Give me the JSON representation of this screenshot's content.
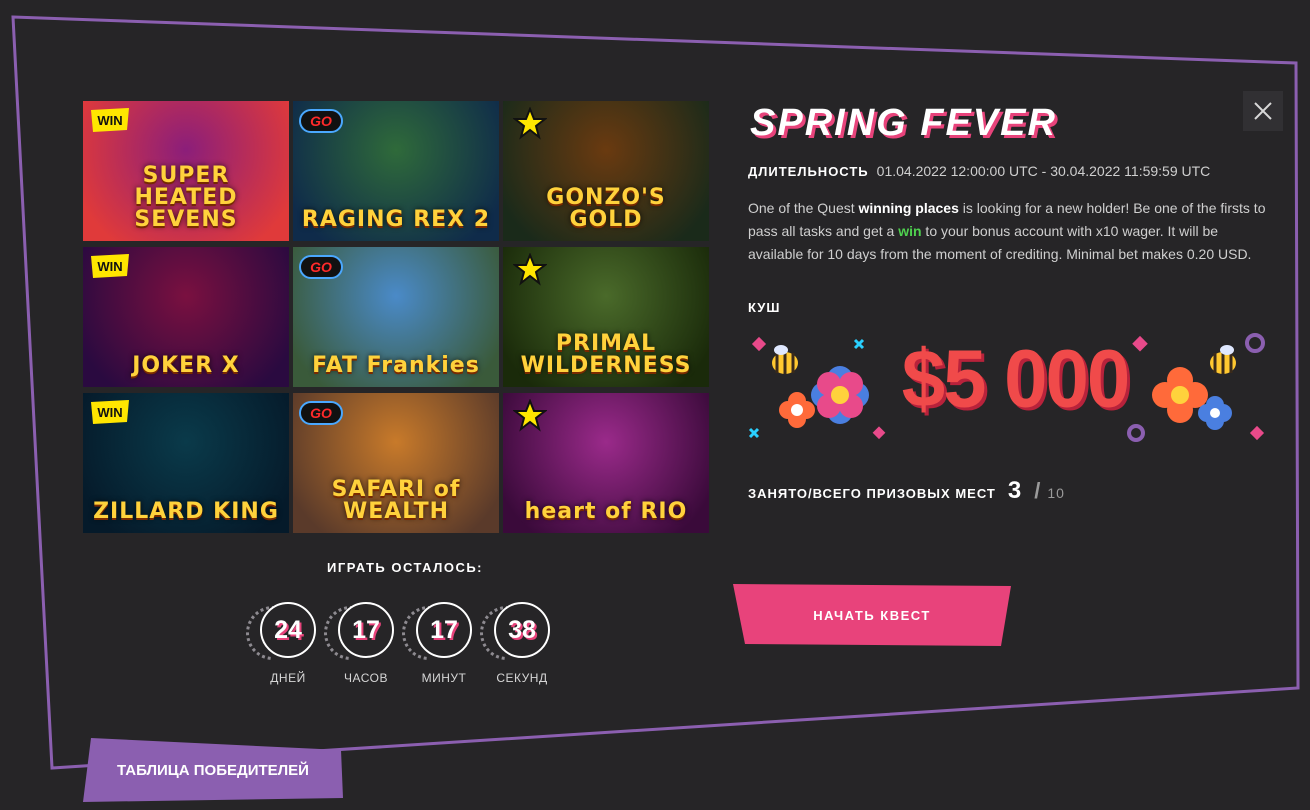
{
  "games": [
    {
      "title": "SUPER HEATED SEVENS",
      "badge": "WIN",
      "bg": [
        "#8b1e7a",
        "#e03a3a"
      ]
    },
    {
      "title": "RAGING REX 2",
      "badge": "GO",
      "bg": [
        "#2f6a3a",
        "#0f2b4a"
      ]
    },
    {
      "title": "GONZO'S GOLD",
      "badge": "star",
      "bg": [
        "#6a3a10",
        "#1a2a1a"
      ]
    },
    {
      "title": "JOKER X",
      "badge": "WIN",
      "bg": [
        "#7a1040",
        "#2a0a40"
      ]
    },
    {
      "title": "FAT Frankies",
      "badge": "GO",
      "bg": [
        "#4a8ac8",
        "#3a5a3a"
      ]
    },
    {
      "title": "PRIMAL WILDERNESS",
      "badge": "star",
      "bg": [
        "#4a6a2a",
        "#1a2a0a"
      ]
    },
    {
      "title": "ZILLARD KING",
      "badge": "WIN",
      "bg": [
        "#0a3a4a",
        "#051a2a"
      ]
    },
    {
      "title": "SAFARI of WEALTH",
      "badge": "GO",
      "bg": [
        "#c87a2a",
        "#5a3a2a"
      ]
    },
    {
      "title": "heart of RIO",
      "badge": "star",
      "bg": [
        "#9a2a8a",
        "#3a0a3a"
      ]
    }
  ],
  "countdown": {
    "title": "ИГРАТЬ ОСТАЛОСЬ:",
    "items": [
      {
        "value": "24",
        "unit": "ДНЕЙ"
      },
      {
        "value": "17",
        "unit": "ЧАСОВ"
      },
      {
        "value": "17",
        "unit": "МИНУТ"
      },
      {
        "value": "38",
        "unit": "СЕКУНД"
      }
    ]
  },
  "quest": {
    "title": "SPRING FEVER",
    "duration_label": "ДЛИТЕЛЬНОСТЬ",
    "duration_value": "01.04.2022 12:00:00 UTC - 30.04.2022 11:59:59 UTC",
    "desc_1": "One of the Quest ",
    "desc_bold": "winning places",
    "desc_2": " is looking for a new holder! Be one of the firsts to pass all tasks and get a ",
    "desc_win": "win",
    "desc_3": " to your bonus account with x10 wager. It will be available for 10 days from the moment of crediting. Minimal bet makes 0.20 USD.",
    "jackpot_label": "КУШ",
    "jackpot_amount": "$5 000",
    "places_label": "ЗАНЯТО/ВСЕГО ПРИЗОВЫХ МЕСТ",
    "places_taken": "3",
    "places_sep": "/",
    "places_total": "10",
    "start_button": "НАЧАТЬ КВЕСТ"
  },
  "winners_button": "ТАБЛИЦА ПОБЕДИТЕЛЕЙ",
  "colors": {
    "accent": "#e8437b",
    "frame": "#8b5fb0",
    "win_green": "#4fd14f",
    "jackpot": "#f04a4a"
  }
}
